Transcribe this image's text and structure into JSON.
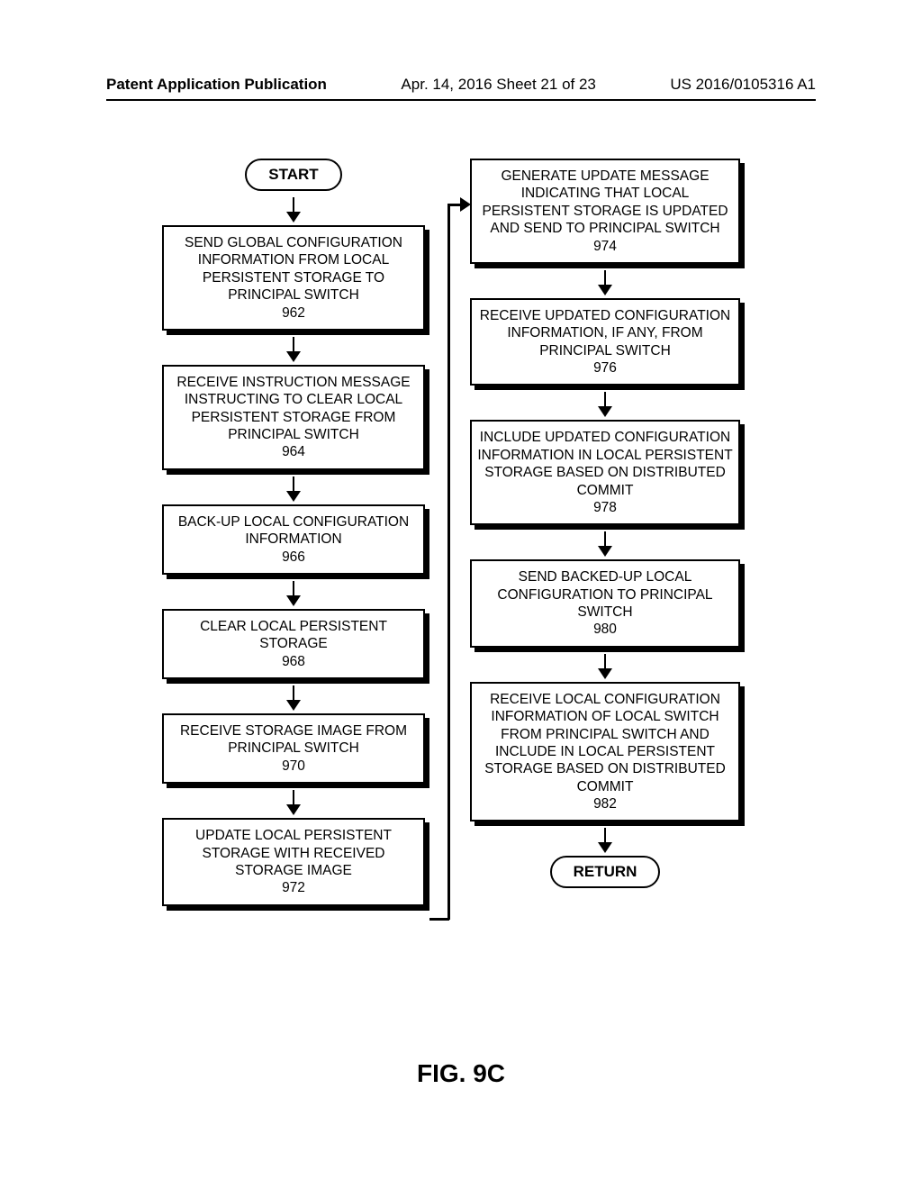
{
  "header": {
    "left": "Patent Application Publication",
    "center": "Apr. 14, 2016  Sheet 21 of 23",
    "right": "US 2016/0105316 A1"
  },
  "terminals": {
    "start": "START",
    "return": "RETURN"
  },
  "left_steps": [
    "SEND GLOBAL CONFIGURATION INFORMATION FROM LOCAL PERSISTENT STORAGE TO PRINCIPAL SWITCH\n962",
    "RECEIVE INSTRUCTION MESSAGE INSTRUCTING TO CLEAR LOCAL PERSISTENT STORAGE FROM PRINCIPAL SWITCH\n964",
    "BACK-UP LOCAL CONFIGURATION INFORMATION\n966",
    "CLEAR LOCAL PERSISTENT STORAGE\n968",
    "RECEIVE STORAGE IMAGE FROM PRINCIPAL SWITCH\n970",
    "UPDATE LOCAL PERSISTENT STORAGE WITH RECEIVED STORAGE IMAGE\n972"
  ],
  "right_steps": [
    "GENERATE UPDATE MESSAGE INDICATING THAT LOCAL PERSISTENT STORAGE IS UPDATED AND SEND TO PRINCIPAL SWITCH\n974",
    "RECEIVE UPDATED CONFIGURATION INFORMATION, IF ANY, FROM PRINCIPAL SWITCH\n976",
    "INCLUDE UPDATED CONFIGURATION INFORMATION IN LOCAL PERSISTENT STORAGE BASED ON DISTRIBUTED COMMIT\n978",
    "SEND BACKED-UP LOCAL CONFIGURATION TO PRINCIPAL SWITCH\n980",
    "RECEIVE LOCAL CONFIGURATION INFORMATION OF LOCAL SWITCH FROM PRINCIPAL SWITCH AND INCLUDE IN LOCAL PERSISTENT STORAGE BASED ON DISTRIBUTED COMMIT\n982"
  ],
  "figure_label": "FIG. 9C",
  "chart_data": {
    "type": "diagram",
    "title": "FIG. 9C",
    "nodes": [
      {
        "id": "start",
        "type": "terminal",
        "label": "START"
      },
      {
        "id": "962",
        "type": "process",
        "label": "SEND GLOBAL CONFIGURATION INFORMATION FROM LOCAL PERSISTENT STORAGE TO PRINCIPAL SWITCH"
      },
      {
        "id": "964",
        "type": "process",
        "label": "RECEIVE INSTRUCTION MESSAGE INSTRUCTING TO CLEAR LOCAL PERSISTENT STORAGE FROM PRINCIPAL SWITCH"
      },
      {
        "id": "966",
        "type": "process",
        "label": "BACK-UP LOCAL CONFIGURATION INFORMATION"
      },
      {
        "id": "968",
        "type": "process",
        "label": "CLEAR LOCAL PERSISTENT STORAGE"
      },
      {
        "id": "970",
        "type": "process",
        "label": "RECEIVE STORAGE IMAGE FROM PRINCIPAL SWITCH"
      },
      {
        "id": "972",
        "type": "process",
        "label": "UPDATE LOCAL PERSISTENT STORAGE WITH RECEIVED STORAGE IMAGE"
      },
      {
        "id": "974",
        "type": "process",
        "label": "GENERATE UPDATE MESSAGE INDICATING THAT LOCAL PERSISTENT STORAGE IS UPDATED AND SEND TO PRINCIPAL SWITCH"
      },
      {
        "id": "976",
        "type": "process",
        "label": "RECEIVE UPDATED CONFIGURATION INFORMATION, IF ANY, FROM PRINCIPAL SWITCH"
      },
      {
        "id": "978",
        "type": "process",
        "label": "INCLUDE UPDATED CONFIGURATION INFORMATION IN LOCAL PERSISTENT STORAGE BASED ON DISTRIBUTED COMMIT"
      },
      {
        "id": "980",
        "type": "process",
        "label": "SEND BACKED-UP LOCAL CONFIGURATION TO PRINCIPAL SWITCH"
      },
      {
        "id": "982",
        "type": "process",
        "label": "RECEIVE LOCAL CONFIGURATION INFORMATION OF LOCAL SWITCH FROM PRINCIPAL SWITCH AND INCLUDE IN LOCAL PERSISTENT STORAGE BASED ON DISTRIBUTED COMMIT"
      },
      {
        "id": "return",
        "type": "terminal",
        "label": "RETURN"
      }
    ],
    "edges": [
      [
        "start",
        "962"
      ],
      [
        "962",
        "964"
      ],
      [
        "964",
        "966"
      ],
      [
        "966",
        "968"
      ],
      [
        "968",
        "970"
      ],
      [
        "970",
        "972"
      ],
      [
        "972",
        "974"
      ],
      [
        "974",
        "976"
      ],
      [
        "976",
        "978"
      ],
      [
        "978",
        "980"
      ],
      [
        "980",
        "982"
      ],
      [
        "982",
        "return"
      ]
    ]
  }
}
